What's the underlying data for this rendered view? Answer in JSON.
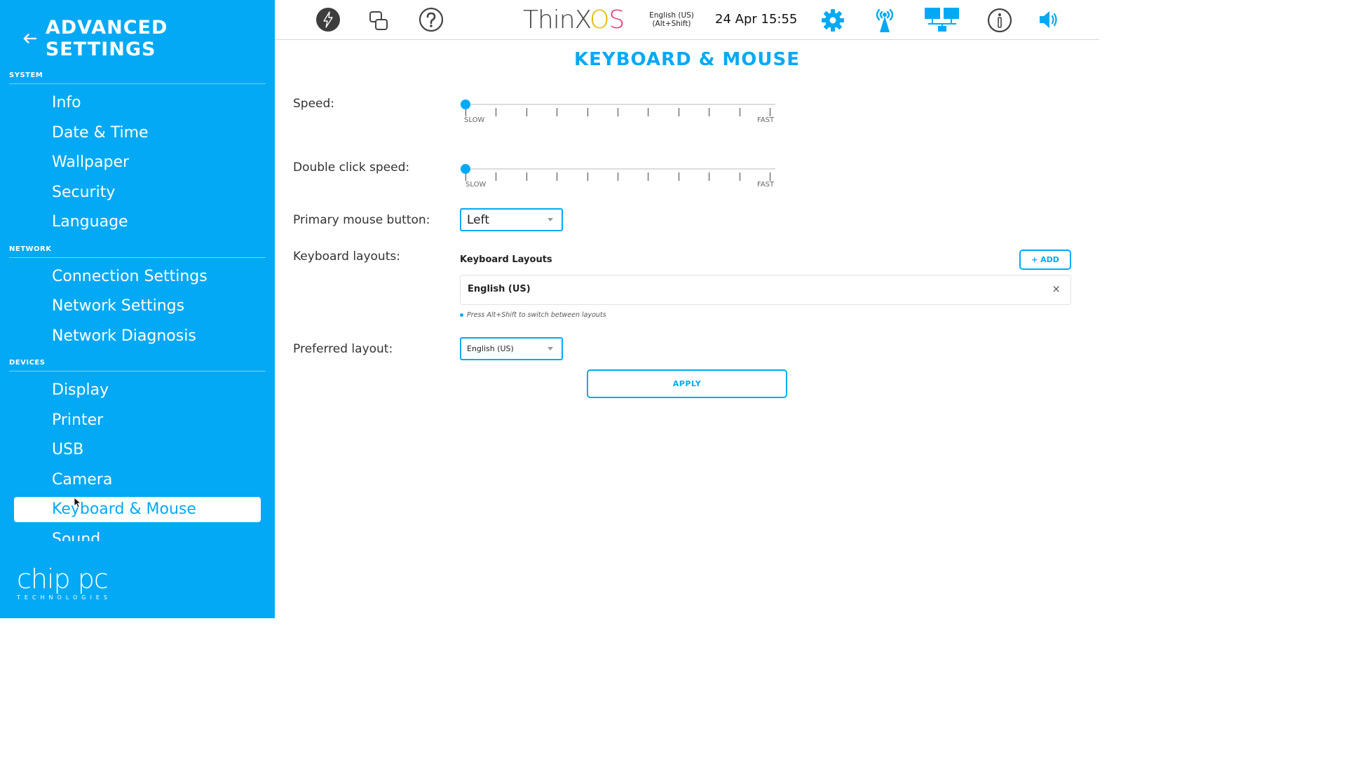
{
  "colors": {
    "accent": "#03a9f4",
    "sidebar_bg": "#03a9f4"
  },
  "sidebar": {
    "title": "ADVANCED SETTINGS",
    "sections": [
      {
        "label": "SYSTEM",
        "items": [
          "Info",
          "Date & Time",
          "Wallpaper",
          "Security",
          "Language"
        ]
      },
      {
        "label": "NETWORK",
        "items": [
          "Connection Settings",
          "Network Settings",
          "Network Diagnosis"
        ]
      },
      {
        "label": "DEVICES",
        "items": [
          "Display",
          "Printer",
          "USB",
          "Camera",
          "Keyboard & Mouse",
          "Sound"
        ]
      }
    ],
    "active_item": "Keyboard & Mouse",
    "logo": {
      "main": "chip pc",
      "sub": "TECHNOLOGIES"
    }
  },
  "topbar": {
    "icons": [
      "lightning-icon",
      "windows-icon",
      "help-icon",
      "settings-icon",
      "wireless-icon",
      "network-icon",
      "info-icon",
      "volume-icon"
    ],
    "brand": {
      "thin": "Thin",
      "x": "X",
      "o": "O",
      "s": "S"
    },
    "language_line1": "English (US)",
    "language_line2": "(Alt+Shift)",
    "datetime": "24 Apr 15:55"
  },
  "main": {
    "title": "KEYBOARD & MOUSE",
    "speed": {
      "label": "Speed:",
      "value": 0,
      "min_label": "SLOW",
      "max_label": "FAST"
    },
    "double_click": {
      "label": "Double click speed:",
      "value": 0,
      "min_label": "SLOW",
      "max_label": "FAST"
    },
    "primary_button": {
      "label": "Primary mouse button:",
      "value": "Left"
    },
    "keyboard_layouts": {
      "label": "Keyboard layouts:",
      "header": "Keyboard Layouts",
      "add_label": "+ ADD",
      "items": [
        "English (US)"
      ],
      "remove_glyph": "×",
      "hint": "Press Alt+Shift to switch between layouts"
    },
    "preferred_layout": {
      "label": "Preferred layout:",
      "value": "English (US)"
    },
    "apply_label": "APPLY"
  }
}
